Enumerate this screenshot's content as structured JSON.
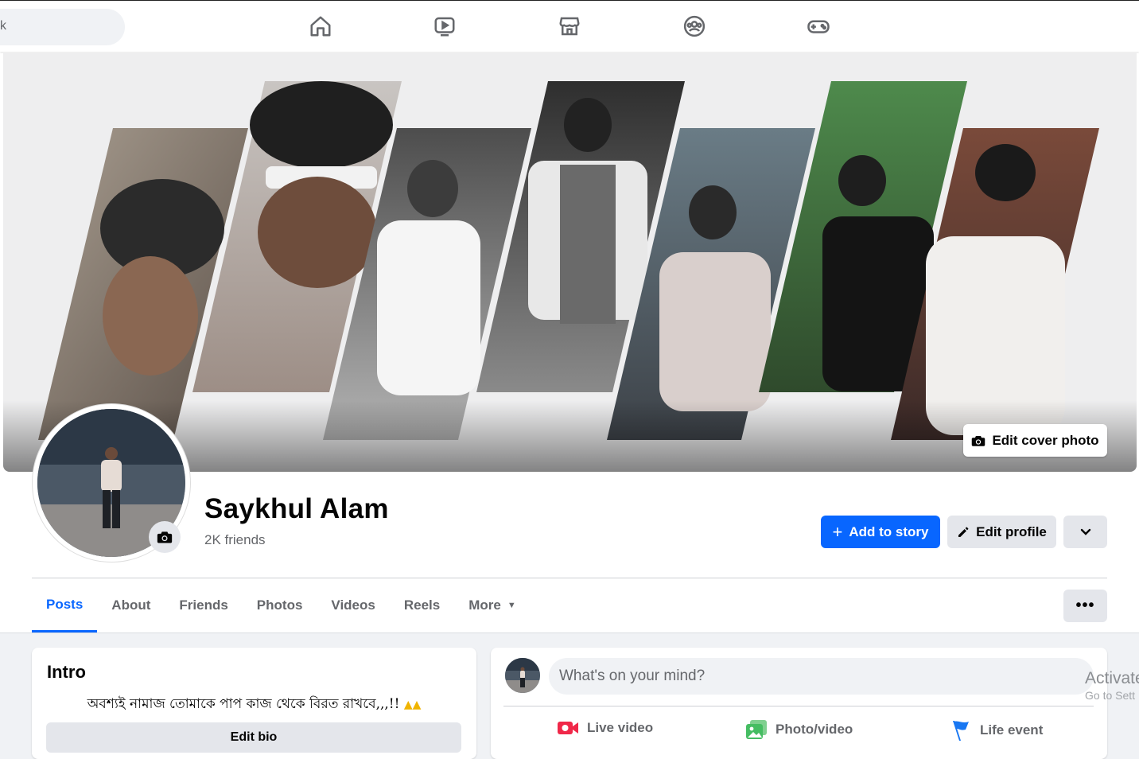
{
  "topbar": {
    "search_glyph": "k",
    "nav": [
      "home-icon",
      "watch-icon",
      "marketplace-icon",
      "groups-icon",
      "gaming-icon"
    ]
  },
  "profile": {
    "name": "Saykhul Alam",
    "friends": "2K friends",
    "edit_cover_label": "Edit cover photo",
    "add_story_label": "Add to story",
    "edit_profile_label": "Edit profile"
  },
  "tabs": [
    {
      "label": "Posts",
      "active": true
    },
    {
      "label": "About"
    },
    {
      "label": "Friends"
    },
    {
      "label": "Photos"
    },
    {
      "label": "Videos"
    },
    {
      "label": "Reels"
    },
    {
      "label": "More"
    }
  ],
  "intro": {
    "title": "Intro",
    "bio": "অবশ্যই নামাজ তোমাকে পাপ কাজ থেকে বিরত রাখবে,,,!!",
    "edit_bio_label": "Edit bio"
  },
  "composer": {
    "placeholder": "What's on your mind?",
    "actions": {
      "live": "Live video",
      "photo": "Photo/video",
      "life": "Life event"
    }
  },
  "overlay": {
    "activate": "Activate",
    "goto": "Go to Sett"
  },
  "colors": {
    "accent": "#0866ff",
    "live": "#f02849",
    "photo": "#45bd62",
    "life": "#1877f2"
  }
}
